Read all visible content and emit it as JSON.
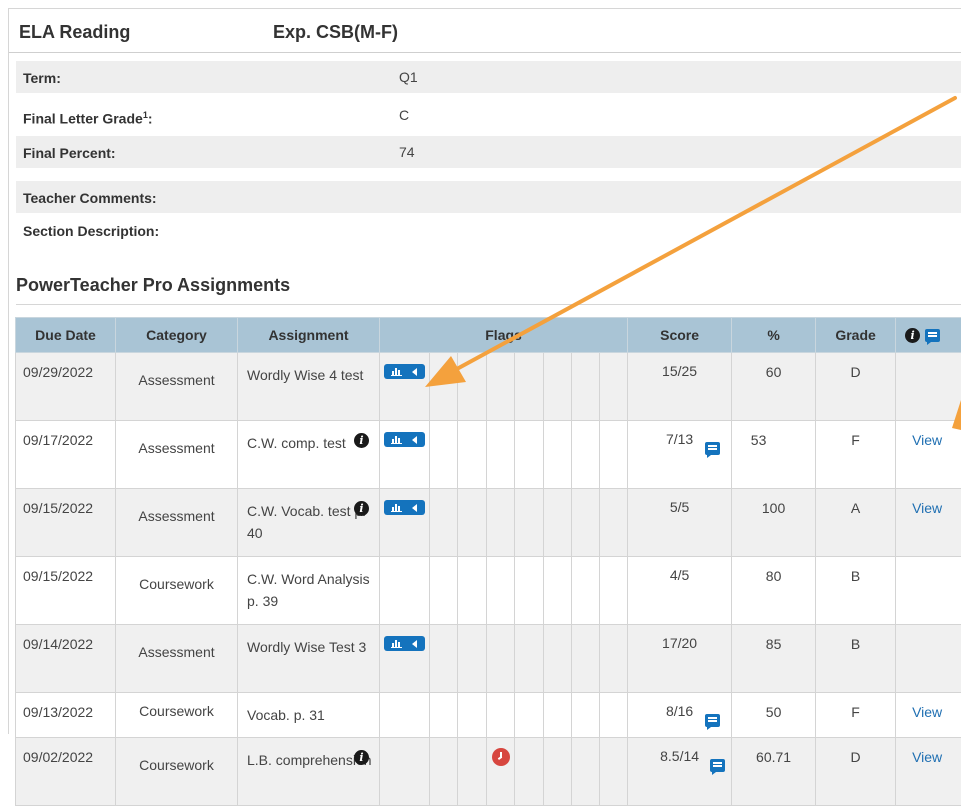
{
  "course": {
    "name": "ELA Reading",
    "section": "Exp. CSB(M-F)"
  },
  "summary": [
    {
      "label": "Term:",
      "value": "Q1"
    },
    {
      "label": "Final Letter Grade",
      "sup": "1",
      "suffix": ":",
      "value": "C"
    },
    {
      "label": "Final Percent:",
      "value": "74"
    },
    {
      "label": "Teacher Comments:",
      "value": ""
    },
    {
      "label": "Section Description:",
      "value": ""
    }
  ],
  "assignments_title": "PowerTeacher Pro Assignments",
  "columns": {
    "due": "Due Date",
    "category": "Category",
    "assignment": "Assignment",
    "flags": "Flags",
    "score": "Score",
    "pct": "%",
    "grade": "Grade"
  },
  "rows": [
    {
      "due": "09/29/2022",
      "category": "Assessment",
      "assignment": "Wordly Wise 4 test",
      "score": "15/25",
      "pct": "60",
      "grade": "D",
      "action": ""
    },
    {
      "due": "09/17/2022",
      "category": "Assessment",
      "assignment": "C.W. comp. test",
      "score": "7/13",
      "pct": "53",
      "grade": "F",
      "action": "View"
    },
    {
      "due": "09/15/2022",
      "category": "Assessment",
      "assignment": "C.W. Vocab. test p. 40",
      "score": "5/5",
      "pct": "100",
      "grade": "A",
      "action": "View"
    },
    {
      "due": "09/15/2022",
      "category": "Coursework",
      "assignment": "C.W. Word Analysis p. 39",
      "score": "4/5",
      "pct": "80",
      "grade": "B",
      "action": ""
    },
    {
      "due": "09/14/2022",
      "category": "Assessment",
      "assignment": "Wordly Wise Test 3",
      "score": "17/20",
      "pct": "85",
      "grade": "B",
      "action": ""
    },
    {
      "due": "09/13/2022",
      "category": "Coursework",
      "assignment": "Vocab. p. 31",
      "score": "8/16",
      "pct": "50",
      "grade": "F",
      "action": "View"
    },
    {
      "due": "09/02/2022",
      "category": "Coursework",
      "assignment": "L.B. comprehension",
      "score": "8.5/14",
      "pct": "60.71",
      "grade": "D",
      "action": "View"
    }
  ],
  "colors": {
    "header_bg": "#a9c4d5",
    "flag_blue": "#1473bd",
    "late_red": "#d7463f",
    "arrow": "#f4a13d",
    "link": "#1f6fb2"
  }
}
